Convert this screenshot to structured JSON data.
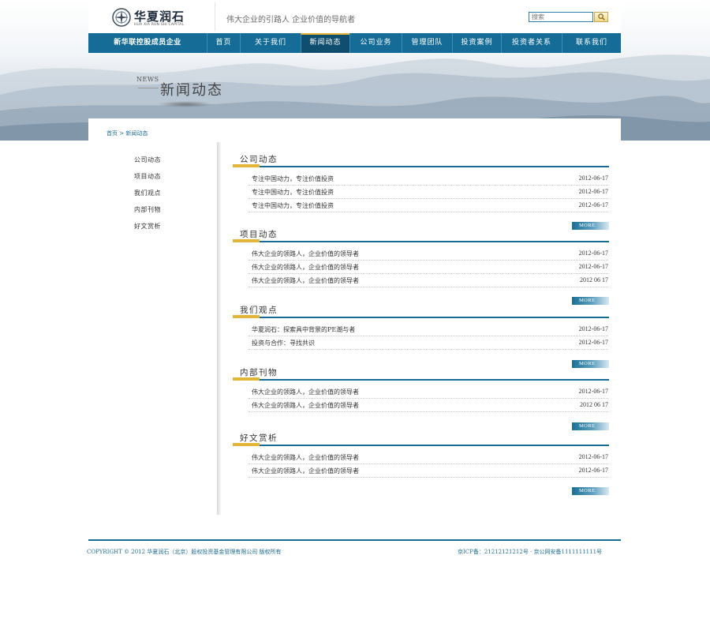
{
  "header": {
    "logo_cn": "华夏润石",
    "logo_en": "HUA XIA RUN SHI CAPITAL",
    "slogan": "伟大企业的引路人  企业价值的导航者",
    "search_placeholder": "搜索"
  },
  "nav": {
    "brand": "新华联控股成员企业",
    "items": [
      "首页",
      "关于我们",
      "新闻动态",
      "公司业务",
      "管理团队",
      "投资案例",
      "投资者关系",
      "联系我们"
    ],
    "active_index": 2
  },
  "banner": {
    "en_label": "NEWS",
    "cn_label": "新闻动态"
  },
  "breadcrumb": "首页 > 新闻动态",
  "sidebar": {
    "items": [
      "公司动态",
      "项目动态",
      "我们观点",
      "内部刊物",
      "好文赏析"
    ]
  },
  "sections": [
    {
      "title": "公司动态",
      "more": "MORE",
      "rows": [
        {
          "title": "专注中国动力，专注价值投资",
          "date": "2012-06-17"
        },
        {
          "title": "专注中国动力，专注价值投资",
          "date": "2012-06-17"
        },
        {
          "title": "专注中国动力，专注价值投资",
          "date": "2012-06-17"
        }
      ]
    },
    {
      "title": "项目动态",
      "more": "MORE",
      "rows": [
        {
          "title": "伟大企业的领路人，企业价值的领导者",
          "date": "2012-06-17"
        },
        {
          "title": "伟大企业的领路人，企业价值的领导者",
          "date": "2012-06-17"
        },
        {
          "title": "伟大企业的领路人，企业价值的领导者",
          "date": "2012 06 17"
        }
      ]
    },
    {
      "title": "我们观点",
      "more": "MORE",
      "rows": [
        {
          "title": "华夏润石：探索具中背景的PE潮与者",
          "date": "2012-06-17"
        },
        {
          "title": "投资与合作：寻找共识",
          "date": "2012-06-17"
        }
      ]
    },
    {
      "title": "内部刊物",
      "more": "MORE",
      "rows": [
        {
          "title": "伟大企业的领路人，企业价值的领导者",
          "date": "2012-06-17"
        },
        {
          "title": "伟大企业的领路人，企业价值的领导者",
          "date": "2012 06 17"
        }
      ]
    },
    {
      "title": "好文赏析",
      "more": "MORE",
      "rows": [
        {
          "title": "伟大企业的领路人，企业价值的领导者",
          "date": "2012-06-17"
        },
        {
          "title": "伟大企业的领路人，企业价值的领导者",
          "date": "2012-06-17"
        }
      ]
    }
  ],
  "footer": {
    "copyright": "COPYRIGHT © 2012 华夏润石（北京）股权投资基金管理有限公司 版权所有",
    "icp": "京ICP备：21212121212号 · 京公网安备1111111111号"
  },
  "colors": {
    "primary_blue": "#156d97",
    "accent_gold": "#e4b53b",
    "link_blue": "#1f6f96"
  },
  "icons": {
    "search": "search-icon",
    "logo": "logo-icon"
  }
}
